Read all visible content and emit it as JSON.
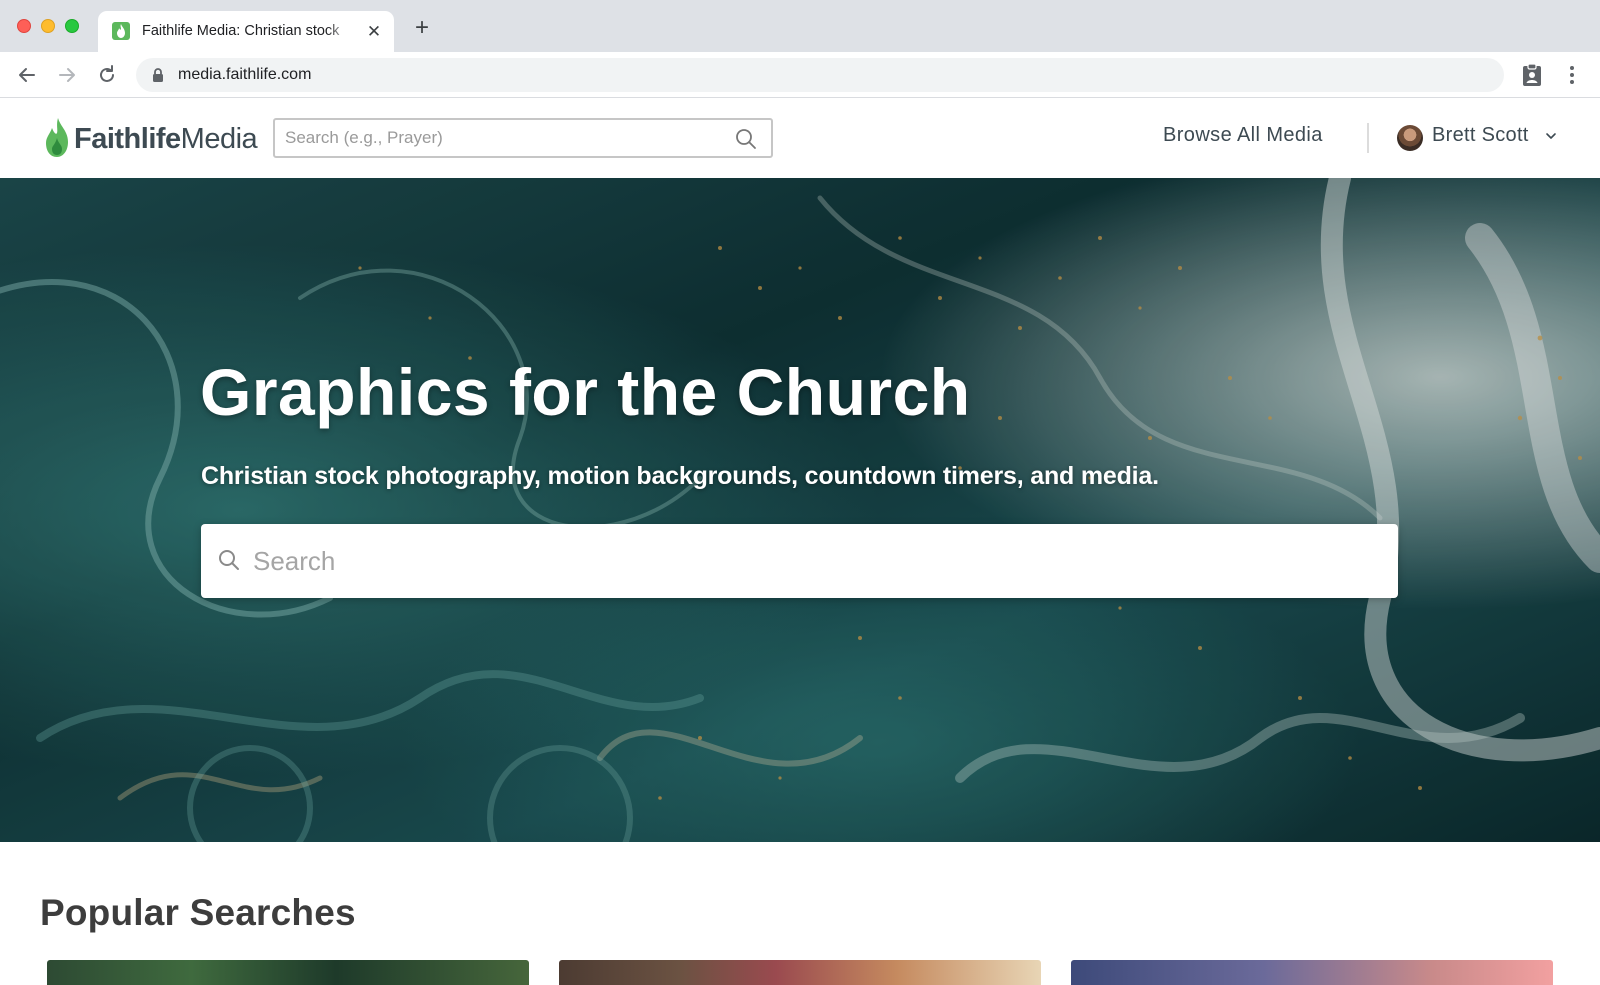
{
  "browser": {
    "tab_title": "Faithlife Media: Christian stock",
    "tab_close": "✕",
    "new_tab": "+",
    "url": "media.faithlife.com"
  },
  "header": {
    "logo_bold": "Faithlife",
    "logo_light": "Media",
    "search_placeholder": "Search (e.g., Prayer)",
    "browse_label": "Browse All Media",
    "user_name": "Brett Scott"
  },
  "hero": {
    "title": "Graphics for the Church",
    "subtitle": "Christian stock photography, motion backgrounds, countdown timers, and media.",
    "search_placeholder": "Search"
  },
  "popular": {
    "title": "Popular Searches"
  },
  "colors": {
    "brand_green": "#5cb85c",
    "header_text": "#3d4a52",
    "hero_teal": "#153a3d"
  }
}
